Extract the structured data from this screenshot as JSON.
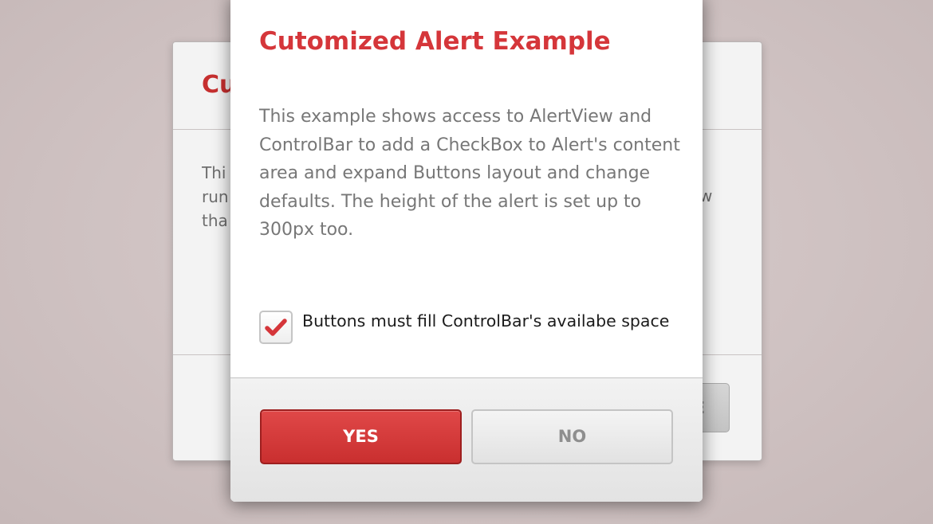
{
  "background_alert": {
    "title_fragment": "Cu",
    "text_fragments": [
      "Thi",
      "run",
      "tha"
    ],
    "text_right_fragment": "w",
    "button_fragment": "E"
  },
  "dialog": {
    "title": "Cutomized Alert Example",
    "message": "This example shows access to AlertView and ControlBar to add a CheckBox to Alert's content area and expand Buttons layout and change defaults. The height of the alert is set up to 300px too.",
    "checkbox": {
      "label": "Buttons must fill ControlBar's availabe space",
      "checked": true,
      "icon": "checkmark-icon"
    },
    "buttons": {
      "yes_label": "YES",
      "no_label": "NO"
    }
  },
  "colors": {
    "accent": "#d5363a",
    "yes_button": "#d23a3a",
    "backdrop": "#cdbfbf"
  }
}
